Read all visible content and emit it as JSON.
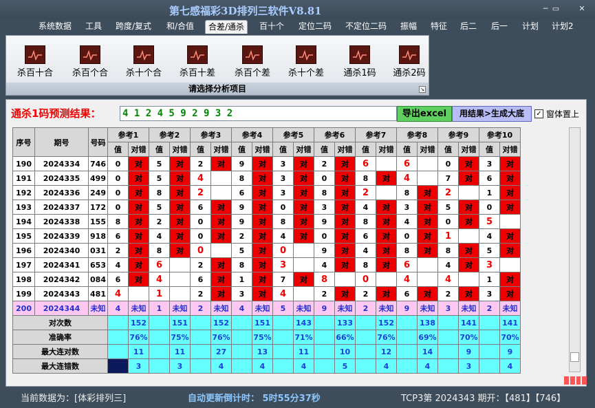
{
  "title": "第七感福彩3D排列三软件V8.81",
  "window_controls": [
    "─",
    "▭",
    "✕"
  ],
  "menu": [
    "系统数据",
    "工具",
    "跨度/复式",
    "和/合值",
    "合差/通杀",
    "百十个",
    "定位二码",
    "不定位二码",
    "振幅",
    "特征",
    "后二",
    "后一",
    "计划",
    "计划2"
  ],
  "active_menu": 4,
  "ribbon": {
    "buttons": [
      "杀百十合",
      "杀百个合",
      "杀十个合",
      "杀百十差",
      "杀百个差",
      "杀十个差",
      "通杀1码",
      "通杀2码"
    ],
    "footer": "请选择分析项目"
  },
  "prediction": {
    "label": "通杀1码预测结果：",
    "value": "4 1 2 4 5 9 2 9 3 2",
    "excel_button": "导出excel",
    "generate_button": "用结果>生成大底",
    "on_top_label": "窗体置上",
    "on_top_checked": true
  },
  "table": {
    "headers": {
      "seq": "序号",
      "period": "期号",
      "code": "号码",
      "refs": [
        "参考1",
        "参考2",
        "参考3",
        "参考4",
        "参考5",
        "参考6",
        "参考7",
        "参考8",
        "参考9",
        "参考10"
      ],
      "val": "值",
      "ok": "对错"
    },
    "rows": [
      {
        "seq": "190",
        "period": "2024334",
        "code": "746",
        "refs": [
          [
            "0",
            "对"
          ],
          [
            "5",
            "对"
          ],
          [
            "2",
            "对"
          ],
          [
            "9",
            "对"
          ],
          [
            "3",
            "对"
          ],
          [
            "2",
            "对"
          ],
          [
            "6",
            ""
          ],
          [
            "6",
            ""
          ],
          [
            "0",
            "对"
          ],
          [
            "3",
            "对"
          ]
        ]
      },
      {
        "seq": "191",
        "period": "2024335",
        "code": "499",
        "refs": [
          [
            "0",
            "对"
          ],
          [
            "5",
            "对"
          ],
          [
            "4",
            ""
          ],
          [
            "8",
            "对"
          ],
          [
            "3",
            "对"
          ],
          [
            "0",
            "对"
          ],
          [
            "8",
            "对"
          ],
          [
            "4",
            ""
          ],
          [
            "7",
            "对"
          ],
          [
            "6",
            "对"
          ]
        ]
      },
      {
        "seq": "192",
        "period": "2024336",
        "code": "249",
        "refs": [
          [
            "0",
            "对"
          ],
          [
            "8",
            "对"
          ],
          [
            "2",
            ""
          ],
          [
            "6",
            "对"
          ],
          [
            "3",
            "对"
          ],
          [
            "8",
            "对"
          ],
          [
            "2",
            ""
          ],
          [
            "8",
            "对"
          ],
          [
            "2",
            ""
          ],
          [
            "1",
            "对"
          ]
        ]
      },
      {
        "seq": "193",
        "period": "2024337",
        "code": "172",
        "refs": [
          [
            "0",
            "对"
          ],
          [
            "5",
            "对"
          ],
          [
            "6",
            "对"
          ],
          [
            "9",
            "对"
          ],
          [
            "0",
            "对"
          ],
          [
            "3",
            "对"
          ],
          [
            "4",
            "对"
          ],
          [
            "3",
            "对"
          ],
          [
            "5",
            "对"
          ],
          [
            "0",
            "对"
          ]
        ]
      },
      {
        "seq": "194",
        "period": "2024338",
        "code": "155",
        "refs": [
          [
            "8",
            "对"
          ],
          [
            "2",
            "对"
          ],
          [
            "0",
            "对"
          ],
          [
            "9",
            "对"
          ],
          [
            "8",
            "对"
          ],
          [
            "9",
            "对"
          ],
          [
            "8",
            "对"
          ],
          [
            "4",
            "对"
          ],
          [
            "0",
            "对"
          ],
          [
            "5",
            ""
          ]
        ]
      },
      {
        "seq": "195",
        "period": "2024339",
        "code": "918",
        "refs": [
          [
            "6",
            "对"
          ],
          [
            "4",
            "对"
          ],
          [
            "0",
            "对"
          ],
          [
            "2",
            "对"
          ],
          [
            "4",
            "对"
          ],
          [
            "0",
            "对"
          ],
          [
            "6",
            "对"
          ],
          [
            "0",
            "对"
          ],
          [
            "1",
            ""
          ],
          [
            "4",
            "对"
          ]
        ]
      },
      {
        "seq": "196",
        "period": "2024340",
        "code": "031",
        "refs": [
          [
            "2",
            "对"
          ],
          [
            "8",
            "对"
          ],
          [
            "0",
            ""
          ],
          [
            "5",
            "对"
          ],
          [
            "0",
            ""
          ],
          [
            "9",
            "对"
          ],
          [
            "4",
            "对"
          ],
          [
            "8",
            "对"
          ],
          [
            "8",
            "对"
          ],
          [
            "5",
            "对"
          ]
        ]
      },
      {
        "seq": "197",
        "period": "2024341",
        "code": "653",
        "refs": [
          [
            "4",
            "对"
          ],
          [
            "6",
            ""
          ],
          [
            "2",
            "对"
          ],
          [
            "8",
            "对"
          ],
          [
            "3",
            ""
          ],
          [
            "4",
            "对"
          ],
          [
            "8",
            "对"
          ],
          [
            "6",
            ""
          ],
          [
            "4",
            "对"
          ],
          [
            "3",
            ""
          ]
        ]
      },
      {
        "seq": "198",
        "period": "2024342",
        "code": "084",
        "refs": [
          [
            "6",
            "对"
          ],
          [
            "4",
            ""
          ],
          [
            "6",
            "对"
          ],
          [
            "1",
            "对"
          ],
          [
            "7",
            "对"
          ],
          [
            "8",
            ""
          ],
          [
            "0",
            ""
          ],
          [
            "4",
            ""
          ],
          [
            "4",
            ""
          ],
          [
            "1",
            "对"
          ]
        ]
      },
      {
        "seq": "199",
        "period": "2024343",
        "code": "481",
        "refs": [
          [
            "4",
            ""
          ],
          [
            "1",
            ""
          ],
          [
            "2",
            "对"
          ],
          [
            "3",
            "对"
          ],
          [
            "4",
            ""
          ],
          [
            "2",
            "对"
          ],
          [
            "2",
            "对"
          ],
          [
            "6",
            "对"
          ],
          [
            "2",
            "对"
          ],
          [
            "3",
            "对"
          ]
        ]
      }
    ],
    "current": {
      "seq": "200",
      "period": "2024344",
      "code": "未知",
      "values": [
        "4",
        "1",
        "2",
        "4",
        "5",
        "9",
        "2",
        "9",
        "3",
        "2"
      ],
      "unknown": "未知"
    },
    "stats": [
      {
        "label": "对次数",
        "values": [
          "152",
          "151",
          "152",
          "151",
          "143",
          "133",
          "152",
          "138",
          "141",
          "141"
        ]
      },
      {
        "label": "准确率",
        "values": [
          "76%",
          "75%",
          "76%",
          "75%",
          "71%",
          "66%",
          "76%",
          "69%",
          "70%",
          "70%"
        ]
      },
      {
        "label": "最大连对数",
        "values": [
          "11",
          "11",
          "27",
          "13",
          "11",
          "10",
          "12",
          "14",
          "9",
          "9"
        ]
      },
      {
        "label": "最大连错数",
        "values": [
          "3",
          "3",
          "4",
          "4",
          "4",
          "5",
          "4",
          "4",
          "3",
          "4"
        ]
      }
    ]
  },
  "status": {
    "data_label": "当前数据为：[体彩排列三]",
    "countdown": "自动更新倒计时： 5时55分37秒",
    "draw": "TCP3第 2024343 期开：【481】【746】"
  },
  "colors": {
    "hit": "#ee0000",
    "current_row": "#ffc8f3",
    "stat_cell": "#66ffff",
    "title_text": "#a9ccff"
  }
}
